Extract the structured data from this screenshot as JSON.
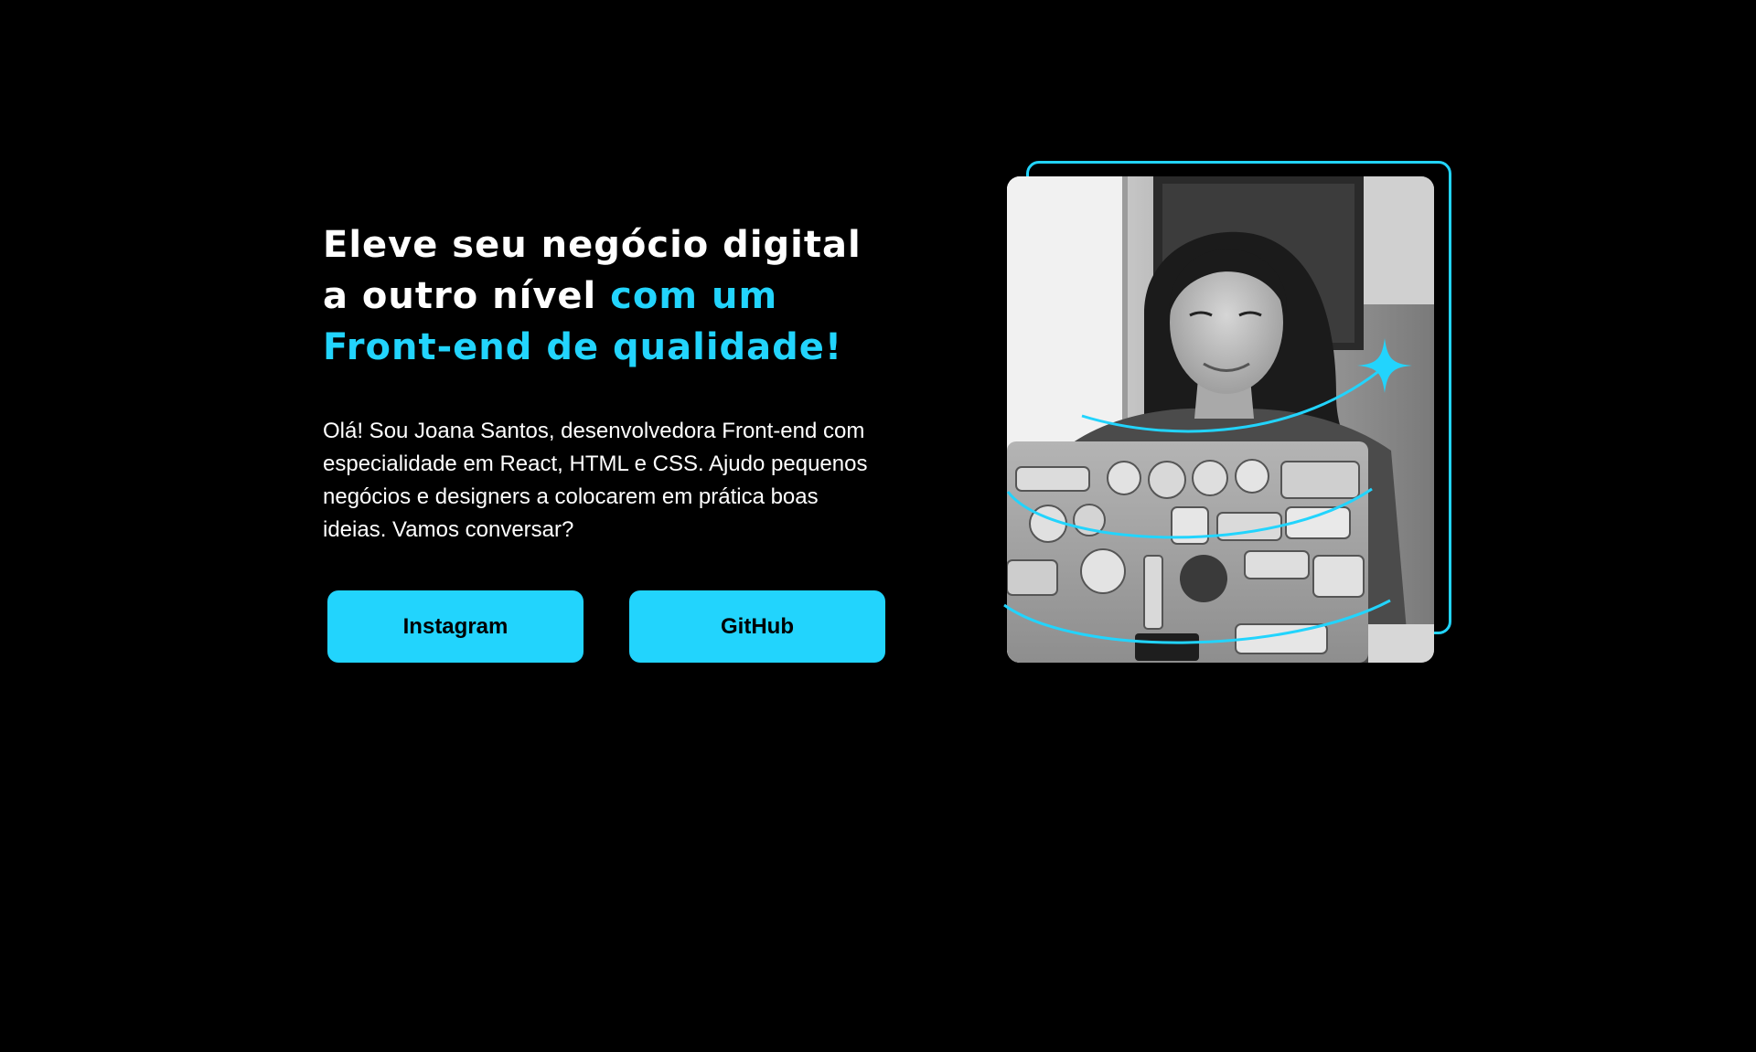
{
  "hero": {
    "headline_line1": "Eleve seu negócio digital",
    "headline_line2_plain": "a outro nível",
    "headline_line2_accent": "com um",
    "headline_line3_accent": "Front-end de qualidade!",
    "intro": "Olá! Sou Joana Santos, desenvolvedora Front-end com especialidade em React, HTML e CSS. Ajudo pequenos negócios e designers a colocarem em prática boas ideias. Vamos conversar?",
    "buttons": {
      "instagram_label": "Instagram",
      "github_label": "GitHub"
    },
    "photo": {
      "alt": "Joana Santos"
    }
  },
  "colors": {
    "background": "#000000",
    "accent": "#22D4FD",
    "text": "#FFFFFF",
    "button_text": "#000000"
  },
  "icons": {
    "sparkle": "sparkle-icon"
  }
}
